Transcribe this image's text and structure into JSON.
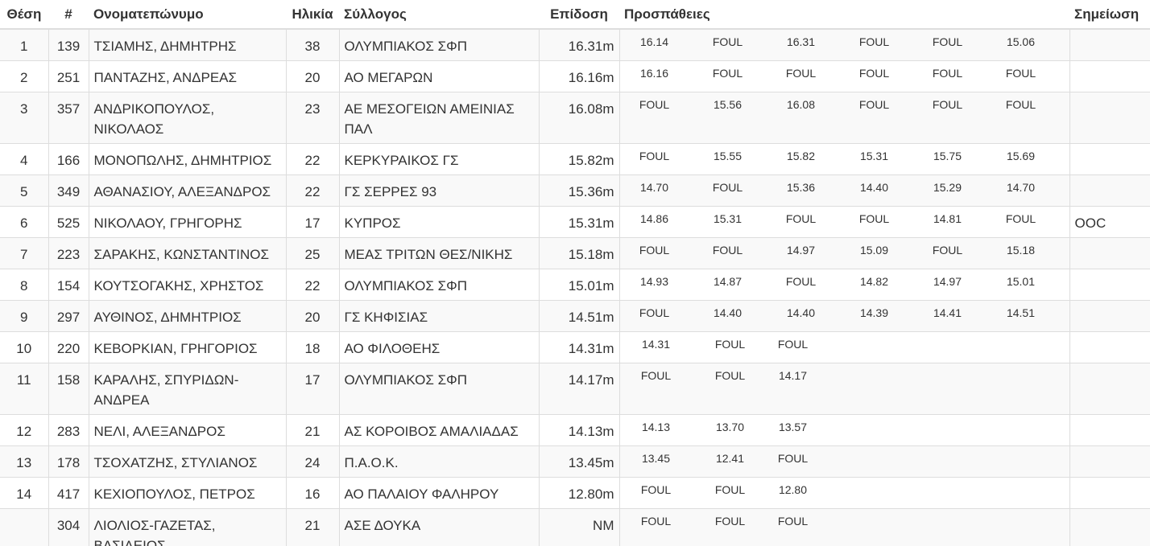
{
  "headers": {
    "position": "Θέση",
    "bib": "#",
    "name": "Ονοματεπώνυμο",
    "age": "Ηλικία",
    "club": "Σύλλογος",
    "mark": "Επίδοση",
    "attempts": "Προσπάθειες",
    "note": "Σημείωση"
  },
  "rows": [
    {
      "position": "1",
      "bib": "139",
      "name": "ΤΣΙΑΜΗΣ, ΔΗΜΗΤΡΗΣ",
      "age": "38",
      "club": "ΟΛΥΜΠΙΑΚΟΣ ΣΦΠ",
      "mark": "16.31m",
      "attempts": [
        "16.14",
        "FOUL",
        "16.31",
        "FOUL",
        "FOUL",
        "15.06"
      ],
      "note": ""
    },
    {
      "position": "2",
      "bib": "251",
      "name": "ΠΑΝΤΑΖΗΣ, ΑΝΔΡΕΑΣ",
      "age": "20",
      "club": "ΑΟ ΜΕΓΑΡΩΝ",
      "mark": "16.16m",
      "attempts": [
        "16.16",
        "FOUL",
        "FOUL",
        "FOUL",
        "FOUL",
        "FOUL"
      ],
      "note": ""
    },
    {
      "position": "3",
      "bib": "357",
      "name": "ΑΝΔΡΙΚΟΠΟΥΛΟΣ, ΝΙΚΟΛΑΟΣ",
      "age": "23",
      "club": "ΑΕ ΜΕΣΟΓΕΙΩΝ ΑΜΕΙΝΙΑΣ ΠΑΛ",
      "mark": "16.08m",
      "attempts": [
        "FOUL",
        "15.56",
        "16.08",
        "FOUL",
        "FOUL",
        "FOUL"
      ],
      "note": ""
    },
    {
      "position": "4",
      "bib": "166",
      "name": "ΜΟΝΟΠΩΛΗΣ, ΔΗΜΗΤΡΙΟΣ",
      "age": "22",
      "club": "ΚΕΡΚΥΡΑΙΚΟΣ ΓΣ",
      "mark": "15.82m",
      "attempts": [
        "FOUL",
        "15.55",
        "15.82",
        "15.31",
        "15.75",
        "15.69"
      ],
      "note": ""
    },
    {
      "position": "5",
      "bib": "349",
      "name": "ΑΘΑΝΑΣΙΟΥ, ΑΛΕΞΑΝΔΡΟΣ",
      "age": "22",
      "club": "ΓΣ ΣΕΡΡΕΣ 93",
      "mark": "15.36m",
      "attempts": [
        "14.70",
        "FOUL",
        "15.36",
        "14.40",
        "15.29",
        "14.70"
      ],
      "note": ""
    },
    {
      "position": "6",
      "bib": "525",
      "name": "ΝΙΚΟΛΑΟΥ, ΓΡΗΓΟΡΗΣ",
      "age": "17",
      "club": "ΚΥΠΡΟΣ",
      "mark": "15.31m",
      "attempts": [
        "14.86",
        "15.31",
        "FOUL",
        "FOUL",
        "14.81",
        "FOUL"
      ],
      "note": "OOC"
    },
    {
      "position": "7",
      "bib": "223",
      "name": "ΣΑΡΑΚΗΣ, ΚΩΝΣΤΑΝΤΙΝΟΣ",
      "age": "25",
      "club": "ΜΕΑΣ ΤΡΙΤΩΝ ΘΕΣ/ΝΙΚΗΣ",
      "mark": "15.18m",
      "attempts": [
        "FOUL",
        "FOUL",
        "14.97",
        "15.09",
        "FOUL",
        "15.18"
      ],
      "note": ""
    },
    {
      "position": "8",
      "bib": "154",
      "name": "ΚΟΥΤΣΟΓΑΚΗΣ, ΧΡΗΣΤΟΣ",
      "age": "22",
      "club": "ΟΛΥΜΠΙΑΚΟΣ ΣΦΠ",
      "mark": "15.01m",
      "attempts": [
        "14.93",
        "14.87",
        "FOUL",
        "14.82",
        "14.97",
        "15.01"
      ],
      "note": ""
    },
    {
      "position": "9",
      "bib": "297",
      "name": "ΑΥΘΙΝΟΣ, ΔΗΜΗΤΡΙΟΣ",
      "age": "20",
      "club": "ΓΣ ΚΗΦΙΣΙΑΣ",
      "mark": "14.51m",
      "attempts": [
        "FOUL",
        "14.40",
        "14.40",
        "14.39",
        "14.41",
        "14.51"
      ],
      "note": ""
    },
    {
      "position": "10",
      "bib": "220",
      "name": "ΚΕΒΟΡΚΙΑΝ, ΓΡΗΓΟΡΙΟΣ",
      "age": "18",
      "club": "ΑΟ ΦΙΛΟΘΕΗΣ",
      "mark": "14.31m",
      "attempts": [
        "14.31",
        "FOUL",
        "FOUL"
      ],
      "note": ""
    },
    {
      "position": "11",
      "bib": "158",
      "name": "ΚΑΡΑΛΗΣ, ΣΠΥΡΙΔΩΝ-ΑΝΔΡΕΑ",
      "age": "17",
      "club": "ΟΛΥΜΠΙΑΚΟΣ ΣΦΠ",
      "mark": "14.17m",
      "attempts": [
        "FOUL",
        "FOUL",
        "14.17"
      ],
      "note": ""
    },
    {
      "position": "12",
      "bib": "283",
      "name": "ΝΕΛΙ, ΑΛΕΞΑΝΔΡΟΣ",
      "age": "21",
      "club": "ΑΣ ΚΟΡΟΙΒΟΣ ΑΜΑΛΙΑΔΑΣ",
      "mark": "14.13m",
      "attempts": [
        "14.13",
        "13.70",
        "13.57"
      ],
      "note": ""
    },
    {
      "position": "13",
      "bib": "178",
      "name": "ΤΣΟΧΑΤΖΗΣ, ΣΤΥΛΙΑΝΟΣ",
      "age": "24",
      "club": "Π.Α.Ο.Κ.",
      "mark": "13.45m",
      "attempts": [
        "13.45",
        "12.41",
        "FOUL"
      ],
      "note": ""
    },
    {
      "position": "14",
      "bib": "417",
      "name": "ΚΕΧΙΟΠΟΥΛΟΣ, ΠΕΤΡΟΣ",
      "age": "16",
      "club": "ΑΟ ΠΑΛΑΙΟΥ ΦΑΛΗΡΟΥ",
      "mark": "12.80m",
      "attempts": [
        "FOUL",
        "FOUL",
        "12.80"
      ],
      "note": ""
    },
    {
      "position": "",
      "bib": "304",
      "name": "ΛΙΟΛΙΟΣ-ΓΑΖΕΤΑΣ, ΒΑΣΙΛΕΙΟΣ",
      "age": "21",
      "club": "ΑΣΕ ΔΟΥΚΑ",
      "mark": "NM",
      "attempts": [
        "FOUL",
        "FOUL",
        "FOUL"
      ],
      "note": ""
    }
  ]
}
